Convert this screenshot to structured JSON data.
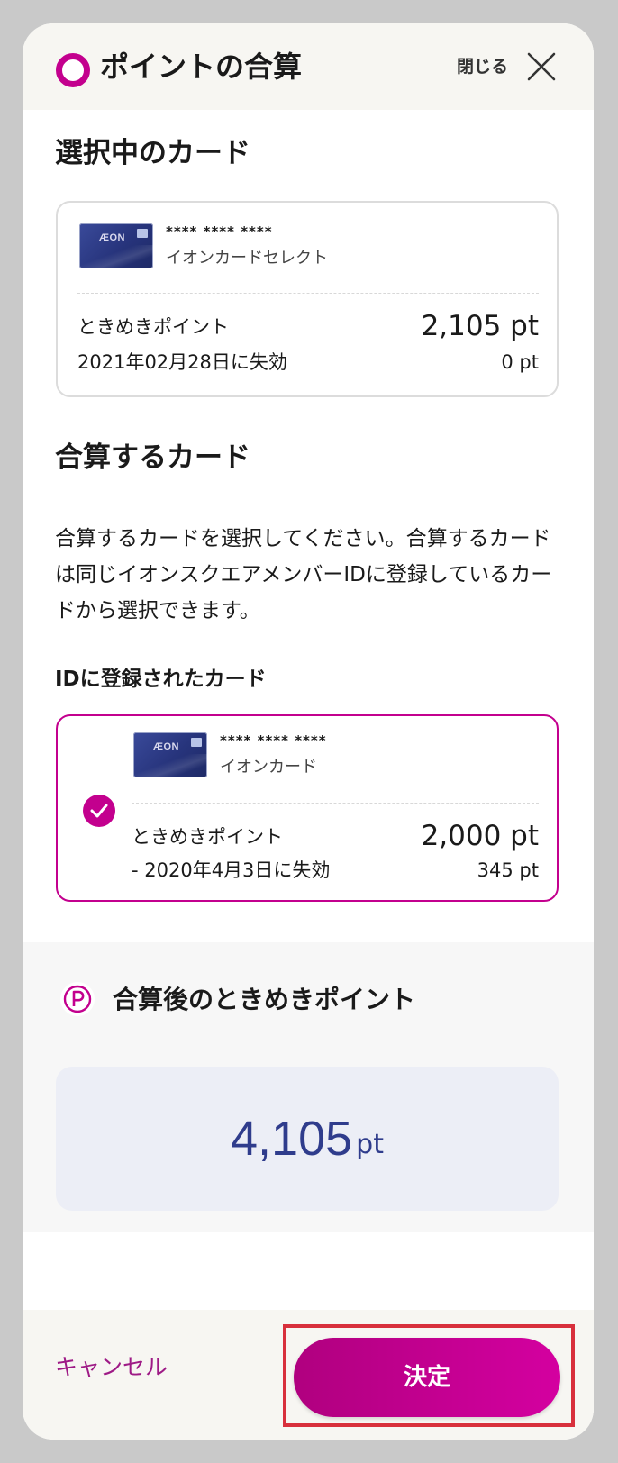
{
  "header": {
    "title": "ポイントの合算",
    "close_label": "閉じる"
  },
  "selected_section": {
    "title": "選択中のカード"
  },
  "selected_card": {
    "brand": "ÆON",
    "number": "**** **** ****",
    "name": "イオンカードセレクト",
    "point_label": "ときめきポイント",
    "points": "2,105 pt",
    "expiry_label": "2021年02月28日に失効",
    "expiry_points": "0 pt"
  },
  "merge_section": {
    "title": "合算するカード",
    "description": "合算するカードを選択してください。合算するカードは同じイオンスクエアメンバーIDに登録しているカードから選択できます。",
    "subheading": "IDに登録されたカード"
  },
  "registered_card": {
    "brand": "ÆON",
    "number": "**** **** ****",
    "name": "イオンカード",
    "point_label": "ときめきポイント",
    "points": "2,000 pt",
    "expiry_label": "- 2020年4月3日に失効",
    "expiry_points": "345 pt",
    "selected": true
  },
  "result": {
    "title": "合算後のときめきポイント",
    "value": "4,105",
    "unit": "pt"
  },
  "footer": {
    "cancel_label": "キャンセル",
    "confirm_label": "決定"
  },
  "colors": {
    "accent": "#c3008e",
    "result_text": "#2f3c8c",
    "highlight": "#d8303c"
  },
  "icons": [
    "logo-ring-icon",
    "close-icon",
    "aeon-card-image",
    "check-icon",
    "point-p-icon"
  ]
}
